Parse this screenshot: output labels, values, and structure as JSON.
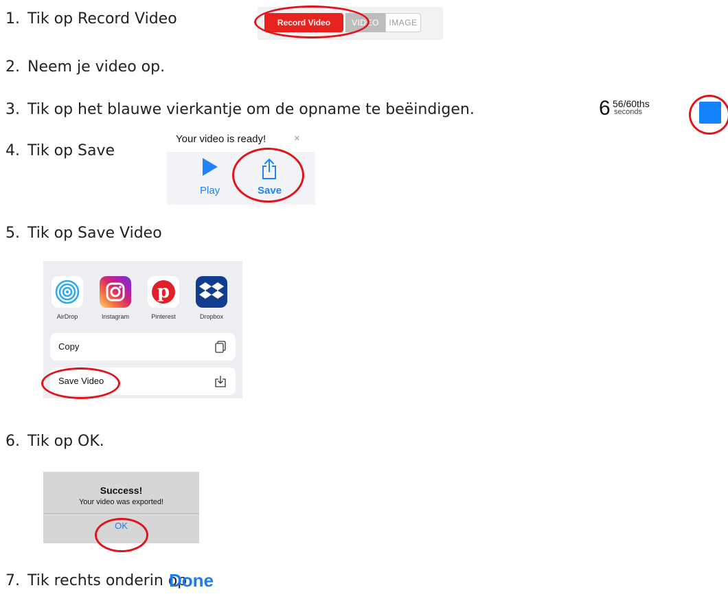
{
  "steps": [
    {
      "num": "1.",
      "text": "Tik op Record Video"
    },
    {
      "num": "2.",
      "text": "Neem je video op."
    },
    {
      "num": "3.",
      "text": "Tik op het blauwe vierkantje om de opname te beëindigen."
    },
    {
      "num": "4.",
      "text": "Tik op Save"
    },
    {
      "num": "5.",
      "text": "Tik op Save Video"
    },
    {
      "num": "6.",
      "text": "Tik op OK."
    },
    {
      "num": "7.",
      "text": "Tik rechts onderin op"
    }
  ],
  "record_toggle": {
    "record_label": "Record Video",
    "video_label": "VIDEO",
    "image_label": "IMAGE"
  },
  "timer": {
    "seconds": "6",
    "fraction": "56/60ths",
    "unit": "seconds"
  },
  "save_popup": {
    "title": "Your video is ready!",
    "close": "×",
    "play_label": "Play",
    "save_label": "Save"
  },
  "share_sheet": {
    "apps": [
      "AirDrop",
      "Instagram",
      "Pinterest",
      "Dropbox"
    ],
    "copy_label": "Copy",
    "save_video_label": "Save Video"
  },
  "alert": {
    "title": "Success!",
    "message": "Your video was exported!",
    "ok_label": "OK"
  },
  "done_label": "Done",
  "colors": {
    "accent_red": "#e1141e",
    "ios_blue": "#1a7cf0",
    "record_red": "#e8231f"
  }
}
